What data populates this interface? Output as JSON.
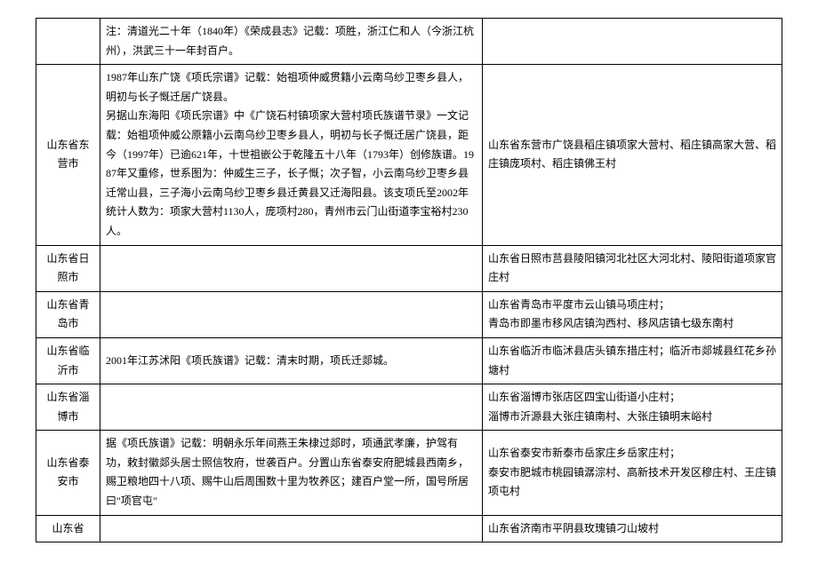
{
  "rows": [
    {
      "region": "",
      "history": "注：清道光二十年（1840年）《荣成县志》记载：项胜，浙江仁和人（今浙江杭州），洪武三十一年封百户。",
      "villages": ""
    },
    {
      "region": "山东省东营市",
      "history": "1987年山东广饶《项氏宗谱》记载：始祖项仲威贯籍小云南乌纱卫枣乡县人，明初与长子慨迁居广饶县。\n另据山东海阳《项氏宗谱》中《广饶石村镇项家大营村项氏族谱节录》一文记载：始祖项仲威公原籍小云南乌纱卫枣乡县人，明初与长子慨迁居广饶县，距今（1997年）已逾621年，十世祖嵌公于乾隆五十八年（1793年）创修族谱。1987年又重修，世系图为：仲威生三子，长子慨；次子智，小云南乌纱卫枣乡县迁常山县，三子海小云南乌纱卫枣乡县迁黄县又迁海阳县。该支项氏至2002年统计人数为：项家大营村1130人，庞项村280，青州市云门山街道李宝裕村230人。",
      "villages": "山东省东营市广饶县稻庄镇项家大营村、稻庄镇高家大营、稻庄镇庞项村、稻庄镇佛王村"
    },
    {
      "region": "山东省日照市",
      "history": "",
      "villages": "山东省日照市莒县陵阳镇河北社区大河北村、陵阳街道项家官庄村"
    },
    {
      "region": "山东省青岛市",
      "history": "",
      "villages": "山东省青岛市平度市云山镇马项庄村；\n青岛市即墨市移风店镇沟西村、移风店镇七级东南村"
    },
    {
      "region": "山东省临沂市",
      "history": "2001年江苏沭阳《项氏族谱》记载：清末时期，项氏迁郯城。",
      "villages": "山东省临沂市临沭县店头镇东措庄村；临沂市郯城县红花乡孙塘村"
    },
    {
      "region": "山东省淄博市",
      "history": "",
      "villages": "山东省淄博市张店区四宝山街道小庄村；\n淄博市沂源县大张庄镇南村、大张庄镇明末峪村"
    },
    {
      "region": "山东省泰安市",
      "history": "据《项氏族谱》记载：明朝永乐年间燕王朱棣过郯时，项通武孝廉，护驾有功，敕封徽郯头居士照信牧府，世袭百户。分置山东省泰安府肥城县西南乡，赐卫粮地四十八项、赐牛山后周围数十里为牧养区；建百户堂一所，国号所居曰\"项官屯\"",
      "villages": "山东省泰安市新泰市岳家庄乡岳家庄村；\n泰安市肥城市桃园镇潺淙村、高新技术开发区穆庄村、王庄镇项屯村"
    },
    {
      "region": "山东省",
      "history": "",
      "villages": "山东省济南市平阴县玫瑰镇刁山坡村"
    }
  ]
}
